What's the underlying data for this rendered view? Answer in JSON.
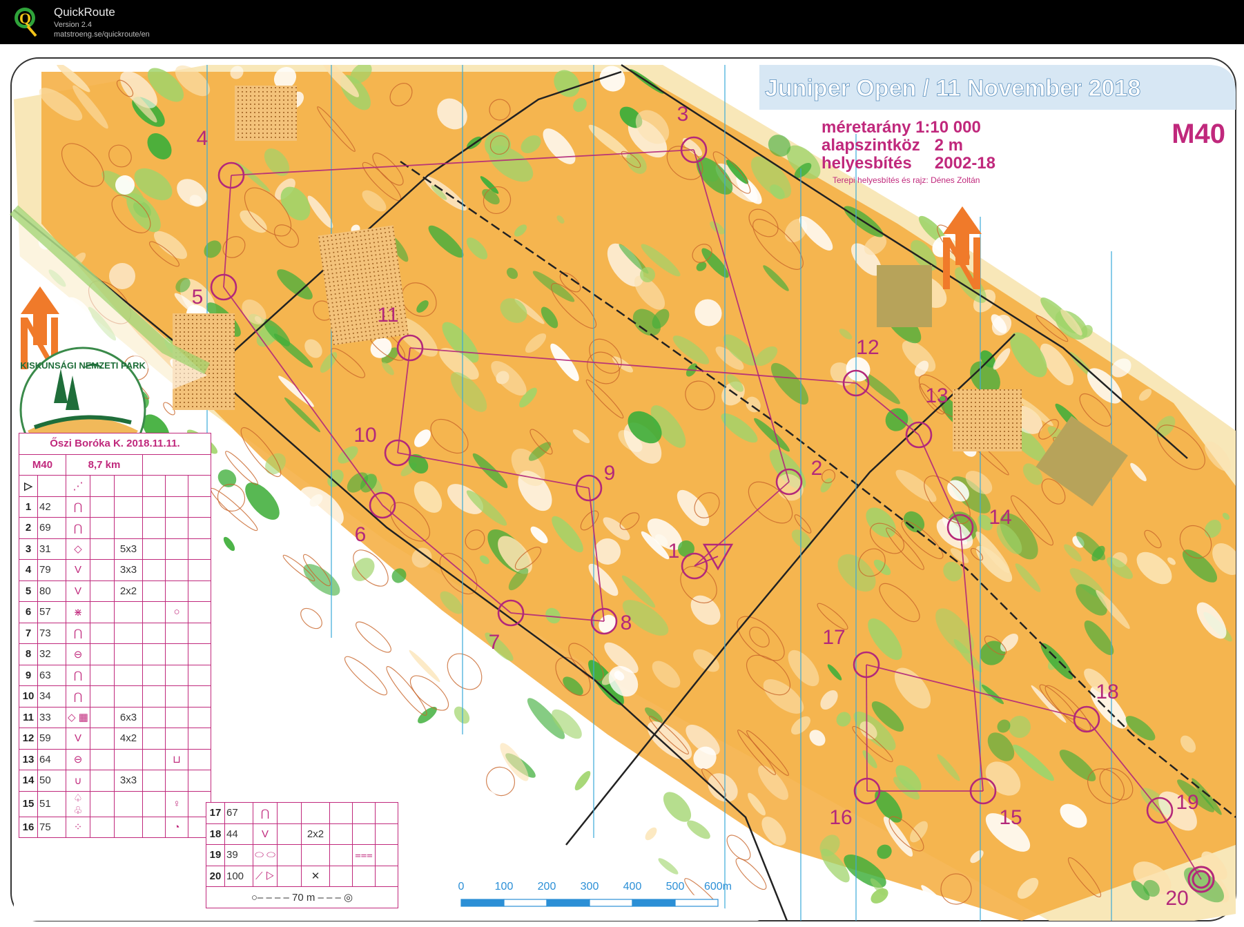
{
  "app": {
    "title": "QuickRoute",
    "version": "Version 2.4",
    "url": "matstroeng.se/quickroute/en"
  },
  "map": {
    "event_title": "Juniper Open / 11 November 2018",
    "scale_label": "méretarány 1:10 000",
    "contour_label": "alapszintköz",
    "contour_value": "2 m",
    "update_label": "helyesbítés",
    "update_value": "2002-18",
    "credit": "Terepi helyesbítés és rajz: Dénes Zoltán",
    "category": "M40",
    "park_name": "KISKUNSÁGI NEMZETI PARK",
    "control_numbers": [
      "1",
      "2",
      "3",
      "4",
      "5",
      "6",
      "7",
      "8",
      "9",
      "10",
      "11",
      "12",
      "13",
      "14",
      "15",
      "16",
      "17",
      "18",
      "19",
      "20"
    ],
    "scalebar": {
      "labels": [
        "0",
        "100",
        "200",
        "300",
        "400",
        "500",
        "600m"
      ]
    }
  },
  "description_sheet": {
    "event": "Őszi Boróka K. 2018.11.11.",
    "class": "M40",
    "length": "8,7 km",
    "rows_left": [
      {
        "n": "1",
        "code": "42",
        "sym": "⋂",
        "dim": "",
        "extra": ""
      },
      {
        "n": "2",
        "code": "69",
        "sym": "⋂",
        "dim": "",
        "extra": ""
      },
      {
        "n": "3",
        "code": "31",
        "sym": "◇",
        "dim": "5x3",
        "extra": ""
      },
      {
        "n": "4",
        "code": "79",
        "sym": "V",
        "dim": "3x3",
        "extra": ""
      },
      {
        "n": "5",
        "code": "80",
        "sym": "V",
        "dim": "2x2",
        "extra": ""
      },
      {
        "n": "6",
        "code": "57",
        "sym": "⋇",
        "dim": "",
        "extra": "○"
      },
      {
        "n": "7",
        "code": "73",
        "sym": "⋂",
        "dim": "",
        "extra": ""
      },
      {
        "n": "8",
        "code": "32",
        "sym": "⊖",
        "dim": "",
        "extra": ""
      },
      {
        "n": "9",
        "code": "63",
        "sym": "⋂",
        "dim": "",
        "extra": ""
      },
      {
        "n": "10",
        "code": "34",
        "sym": "⋂",
        "dim": "",
        "extra": ""
      },
      {
        "n": "11",
        "code": "33",
        "sym": "◇ ▦",
        "dim": "6x3",
        "extra": ""
      },
      {
        "n": "12",
        "code": "59",
        "sym": "V",
        "dim": "4x2",
        "extra": ""
      },
      {
        "n": "13",
        "code": "64",
        "sym": "⊖",
        "dim": "",
        "extra": "⊔"
      },
      {
        "n": "14",
        "code": "50",
        "sym": "∪",
        "dim": "3x3",
        "extra": ""
      },
      {
        "n": "15",
        "code": "51",
        "sym": "♤ ♧",
        "dim": "",
        "extra": "♀"
      },
      {
        "n": "16",
        "code": "75",
        "sym": "⁘",
        "dim": "",
        "extra": "◔"
      }
    ],
    "rows_right": [
      {
        "n": "17",
        "code": "67",
        "sym": "⋂",
        "dim": "",
        "extra": ""
      },
      {
        "n": "18",
        "code": "44",
        "sym": "V",
        "dim": "2x2",
        "extra": ""
      },
      {
        "n": "19",
        "code": "39",
        "sym": "⬭ ⬭",
        "dim": "",
        "extra": "⩶"
      },
      {
        "n": "20",
        "code": "100",
        "sym": "⟋ ▷",
        "dim": "✕",
        "extra": ""
      }
    ],
    "finish_distance": "70 m"
  },
  "colors": {
    "open": "#ffffff",
    "forest_light": "#9fd46a",
    "forest_dark": "#3fae3a",
    "yellow": "#f5a623",
    "contour": "#c8652a",
    "course": "#b3287a",
    "header_band": "#d5e6f3",
    "header_text": "#ffffff",
    "scalebar": "#2b8fd6"
  }
}
